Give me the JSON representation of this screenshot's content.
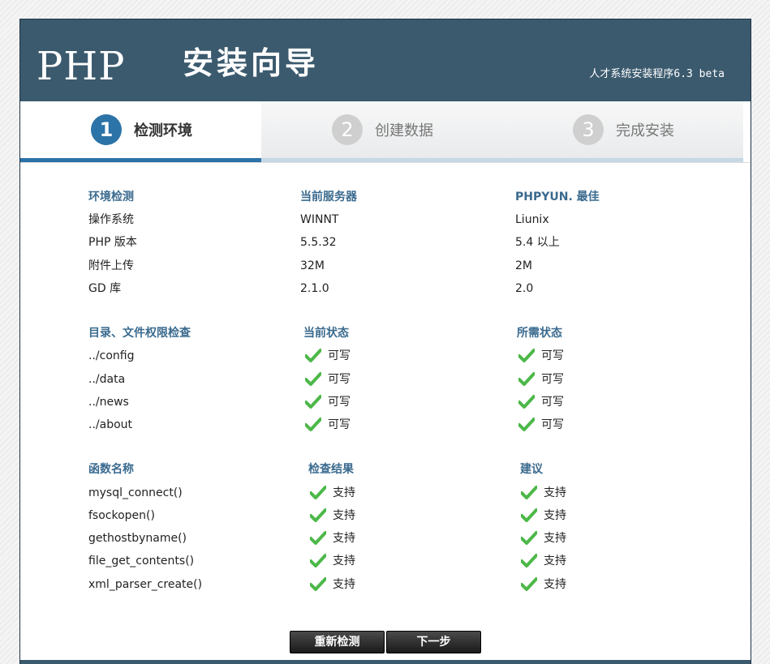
{
  "header": {
    "logo": "PHP",
    "title": "安装向导",
    "version": "人才系统安装程序6.3 beta"
  },
  "steps": [
    {
      "num": "1",
      "label": "检测环境",
      "active": true
    },
    {
      "num": "2",
      "label": "创建数据",
      "active": false
    },
    {
      "num": "3",
      "label": "完成安装",
      "active": false
    }
  ],
  "env": {
    "headers": [
      "环境检测",
      "当前服务器",
      "PHPYUN. 最佳"
    ],
    "rows": [
      [
        "操作系统",
        "WINNT",
        "Liunix"
      ],
      [
        "PHP 版本",
        "5.5.32",
        "5.4 以上"
      ],
      [
        "附件上传",
        "32M",
        "2M"
      ],
      [
        "GD 库",
        "2.1.0",
        "2.0"
      ]
    ]
  },
  "dirs": {
    "headers": [
      "目录、文件权限检查",
      "当前状态",
      "所需状态"
    ],
    "rows": [
      {
        "name": "../config",
        "current": "可写",
        "required": "可写"
      },
      {
        "name": "../data",
        "current": "可写",
        "required": "可写"
      },
      {
        "name": "../news",
        "current": "可写",
        "required": "可写"
      },
      {
        "name": "../about",
        "current": "可写",
        "required": "可写"
      }
    ]
  },
  "funcs": {
    "headers": [
      "函数名称",
      "检查结果",
      "建议"
    ],
    "rows": [
      {
        "name": "mysql_connect()",
        "result": "支持",
        "advice": "支持"
      },
      {
        "name": "fsockopen()",
        "result": "支持",
        "advice": "支持"
      },
      {
        "name": "gethostbyname()",
        "result": "支持",
        "advice": "支持"
      },
      {
        "name": "file_get_contents()",
        "result": "支持",
        "advice": "支持"
      },
      {
        "name": "xml_parser_create()",
        "result": "支持",
        "advice": "支持"
      }
    ]
  },
  "buttons": {
    "recheck": "重新检测",
    "next": "下一步"
  },
  "icons": {
    "check": "check-icon"
  },
  "colors": {
    "header_bg": "#3b5a6e",
    "accent": "#2c73a8",
    "section_heading": "#3a6a8e",
    "check_green": "#4cb848"
  }
}
